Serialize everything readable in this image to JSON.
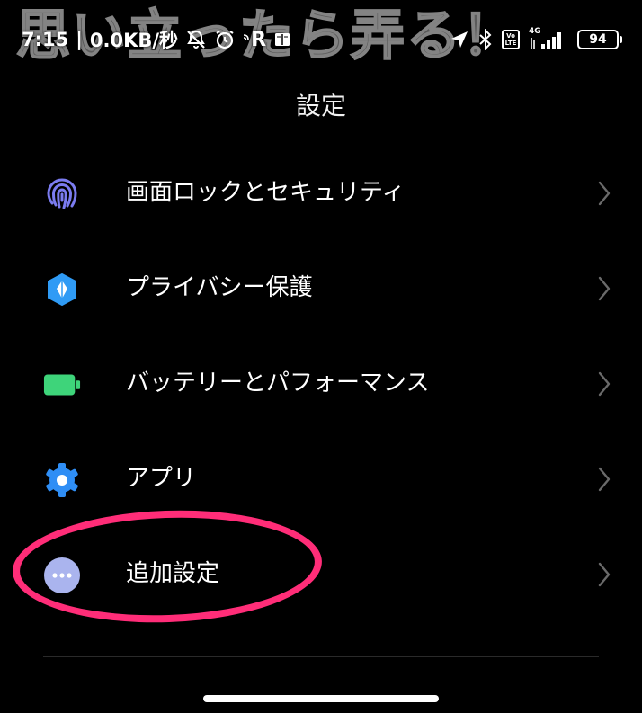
{
  "watermark": {
    "text": "思い立ったら弄る！"
  },
  "status_bar": {
    "time": "7:15",
    "net_speed": "0.0KB/秒",
    "app_icon_letter": "R",
    "network_type": "4G",
    "volte_label": "Vo LTE",
    "battery_level": "94"
  },
  "header": {
    "title": "設定"
  },
  "settings": {
    "items": [
      {
        "label": "画面ロックとセキュリティ",
        "icon": "fingerprint-icon",
        "color": "#7b7cf0"
      },
      {
        "label": "プライバシー保護",
        "icon": "privacy-shield-icon",
        "color": "#2f9bf5"
      },
      {
        "label": "バッテリーとパフォーマンス",
        "icon": "battery-icon",
        "color": "#3ed47a"
      },
      {
        "label": "アプリ",
        "icon": "gear-icon",
        "color": "#2f8ef5"
      },
      {
        "label": "追加設定",
        "icon": "more-dots-icon",
        "color": "#aab4ee"
      }
    ]
  },
  "colors": {
    "background": "#000000",
    "text": "#ffffff",
    "chevron": "#6a6a6a",
    "highlight": "#ff2d78"
  }
}
